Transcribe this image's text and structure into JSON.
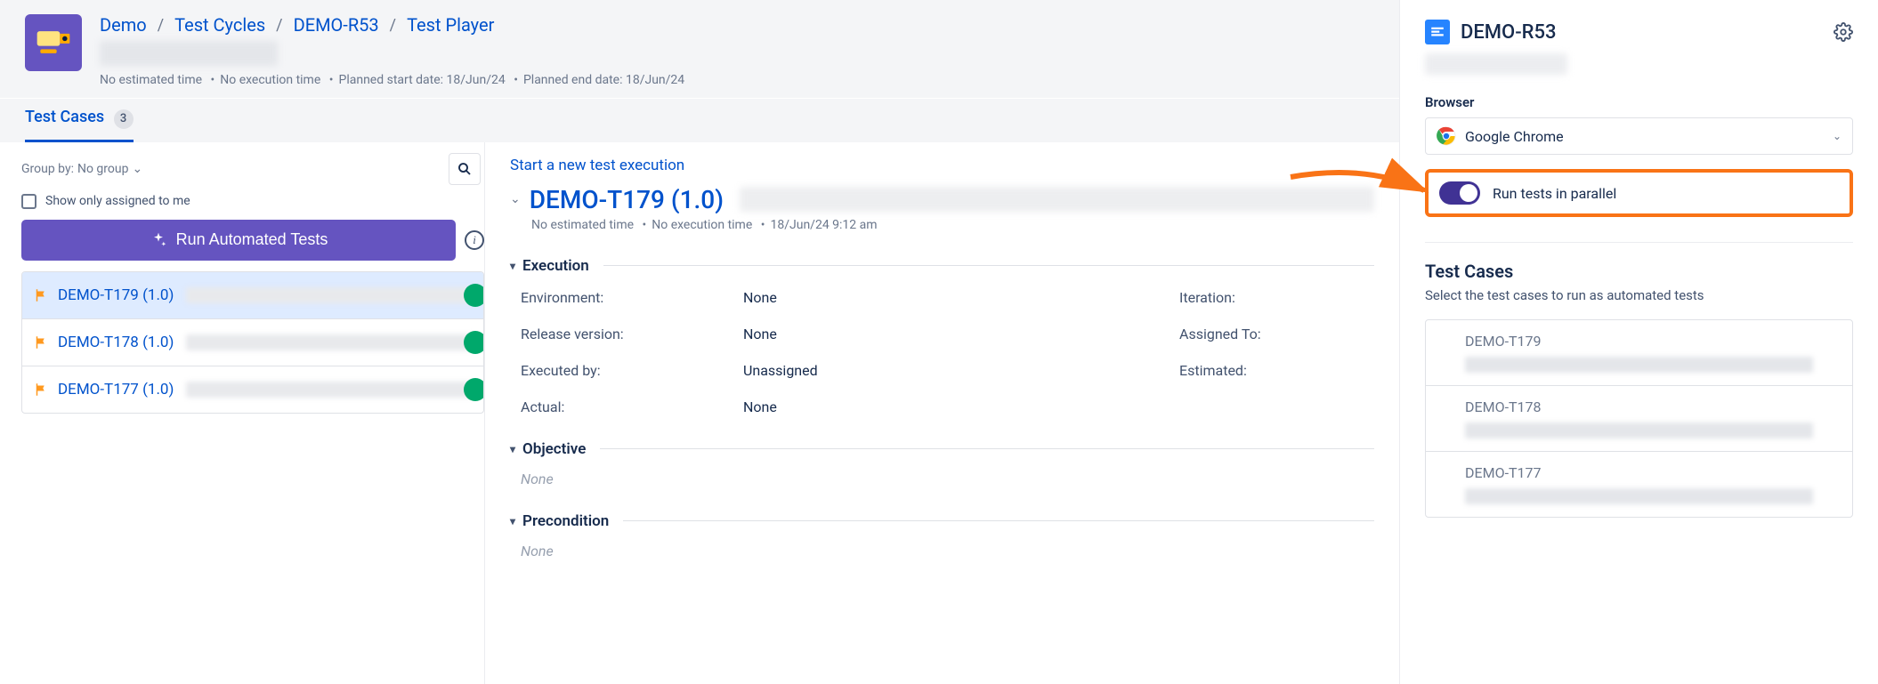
{
  "breadcrumb": {
    "project": "Demo",
    "section": "Test Cycles",
    "cycle": "DEMO-R53",
    "cycleName": "Test Player"
  },
  "headerMeta": {
    "estimated": "No estimated time",
    "execution": "No execution time",
    "plannedStart": "Planned start date: 18/Jun/24",
    "plannedEnd": "Planned end date: 18/Jun/24"
  },
  "tabs": {
    "testCasesLabel": "Test Cases",
    "testCasesCount": "3"
  },
  "leftPanel": {
    "groupByLabel": "Group by:",
    "groupByValue": "No group",
    "assignedLabel": "Show only assigned to me",
    "runButton": "Run Automated Tests",
    "items": [
      {
        "key": "DEMO-T179 (1.0)"
      },
      {
        "key": "DEMO-T178 (1.0)"
      },
      {
        "key": "DEMO-T177 (1.0)"
      }
    ]
  },
  "detail": {
    "startLink": "Start a new test execution",
    "titleKey": "DEMO-T179 (1.0)",
    "meta": {
      "estimated": "No estimated time",
      "execution": "No execution time",
      "datetime": "18/Jun/24 9:12 am"
    },
    "sections": {
      "execution": {
        "title": "Execution",
        "fields": {
          "environmentLabel": "Environment:",
          "environmentValue": "None",
          "iterationLabel": "Iteration:",
          "releaseLabel": "Release version:",
          "releaseValue": "None",
          "assignedLabel": "Assigned To:",
          "executedLabel": "Executed by:",
          "executedValue": "Unassigned",
          "estimatedLabel": "Estimated:",
          "actualLabel": "Actual:",
          "actualValue": "None"
        }
      },
      "objective": {
        "title": "Objective",
        "value": "None"
      },
      "precondition": {
        "title": "Precondition",
        "value": "None"
      }
    }
  },
  "sidebar": {
    "title": "DEMO-R53",
    "browserLabel": "Browser",
    "browserValue": "Google Chrome",
    "toggleLabel": "Run tests in parallel",
    "testCasesTitle": "Test Cases",
    "testCasesSub": "Select the test cases to run as automated tests",
    "items": [
      {
        "key": "DEMO-T179"
      },
      {
        "key": "DEMO-T178"
      },
      {
        "key": "DEMO-T177"
      }
    ]
  }
}
